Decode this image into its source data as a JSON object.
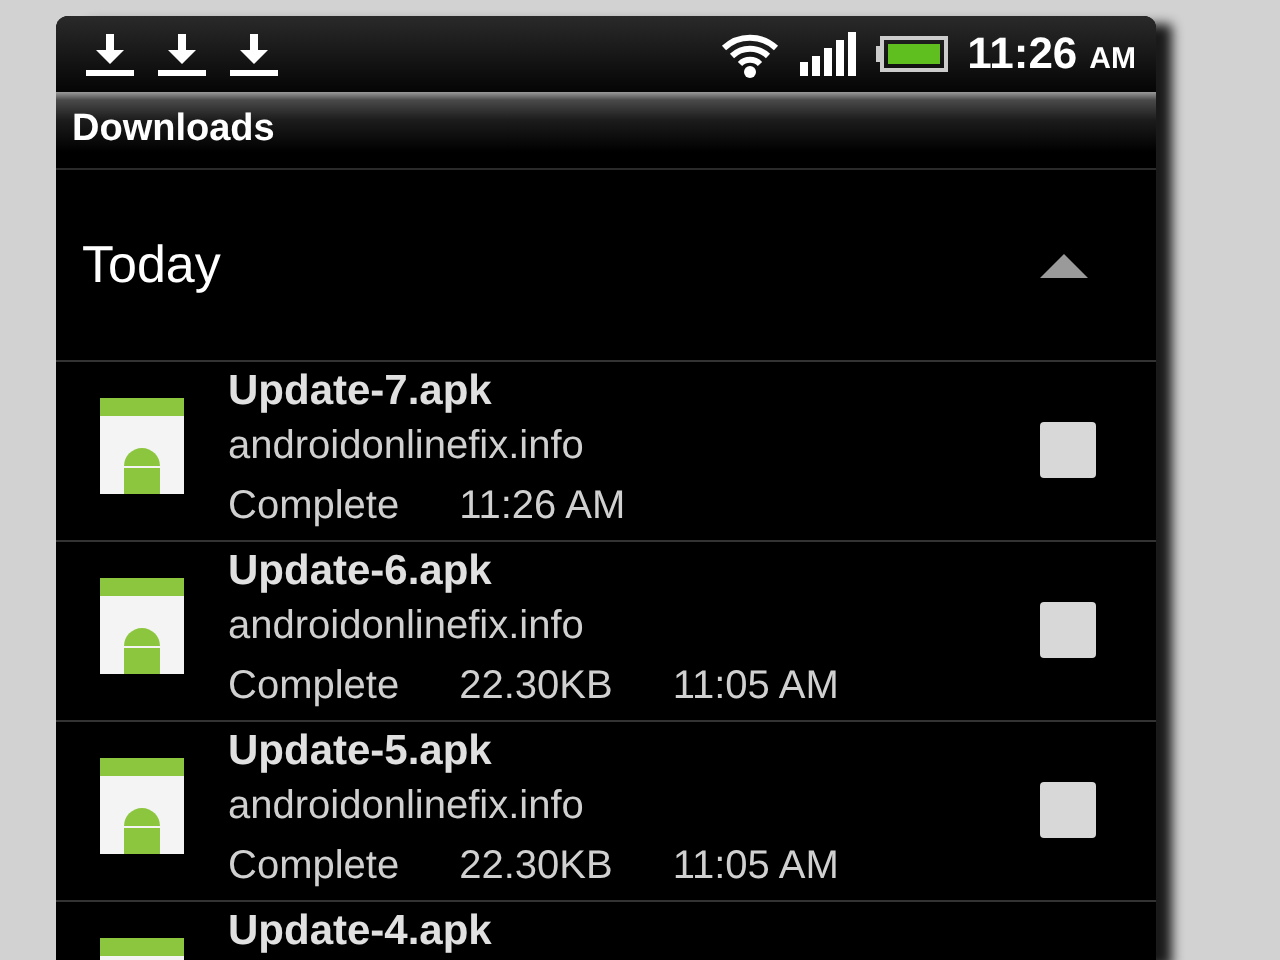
{
  "status_bar": {
    "notifications": [
      {
        "kind": "download"
      },
      {
        "kind": "download"
      },
      {
        "kind": "download"
      }
    ],
    "time": "11:26",
    "ampm": "AM"
  },
  "title_bar": {
    "title": "Downloads"
  },
  "group": {
    "label": "Today",
    "expanded": true
  },
  "downloads": [
    {
      "name": "Update-7.apk",
      "source": "androidonlinefix.info",
      "status": "Complete",
      "time": "11:26 AM",
      "checked": false
    },
    {
      "name": "Update-6.apk",
      "source": "androidonlinefix.info",
      "status": "Complete",
      "size": "22.30KB",
      "time": "11:05 AM",
      "checked": false
    },
    {
      "name": "Update-5.apk",
      "source": "androidonlinefix.info",
      "status": "Complete",
      "size": "22.30KB",
      "time": "11:05 AM",
      "checked": false
    },
    {
      "name": "Update-4.apk"
    }
  ]
}
